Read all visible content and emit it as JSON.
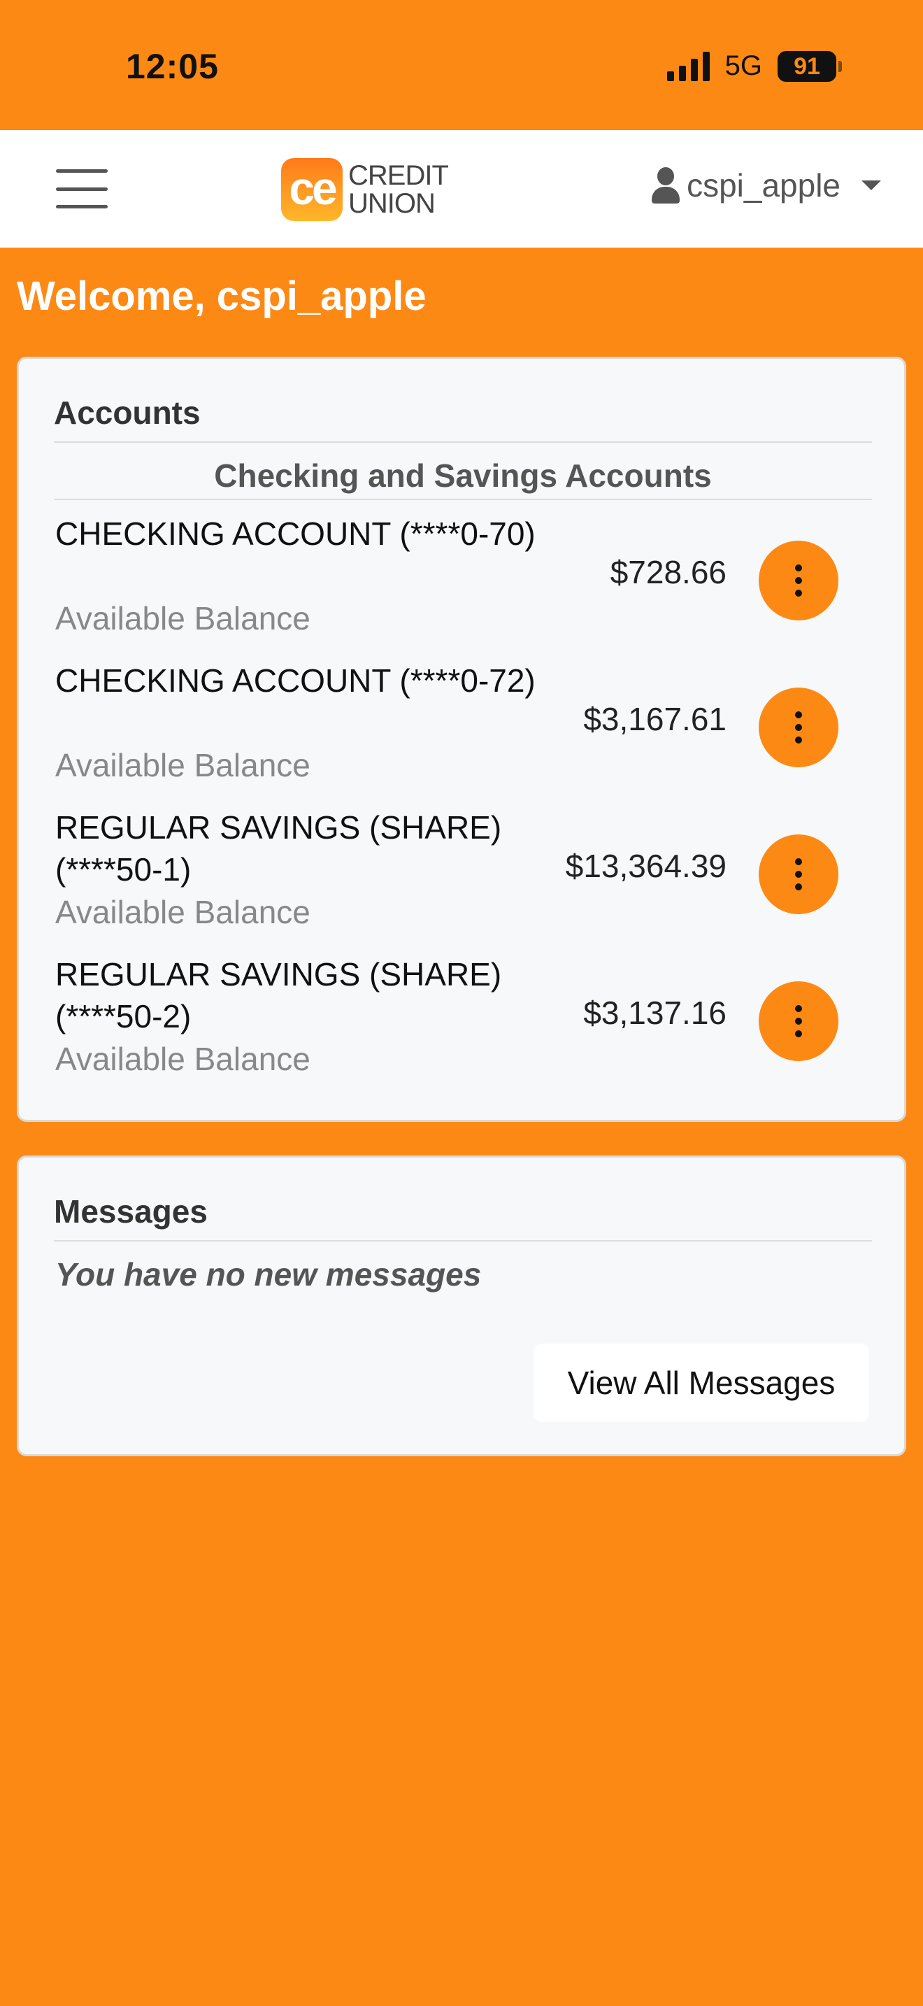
{
  "status": {
    "time": "12:05",
    "network": "5G",
    "battery": "91"
  },
  "navbar": {
    "logo_mark": "ce",
    "logo_line1": "CREDIT",
    "logo_line2": "UNION",
    "username": "cspi_apple"
  },
  "welcome": "Welcome, cspi_apple",
  "accounts": {
    "title": "Accounts",
    "section_title": "Checking and Savings Accounts",
    "items": [
      {
        "name": "CHECKING ACCOUNT (****0-70)",
        "label": "Available Balance",
        "balance": "$728.66"
      },
      {
        "name": "CHECKING ACCOUNT (****0-72)",
        "label": "Available Balance",
        "balance": "$3,167.61"
      },
      {
        "name": "REGULAR SAVINGS (SHARE) (****50-1)",
        "label": "Available Balance",
        "balance": "$13,364.39"
      },
      {
        "name": "REGULAR SAVINGS (SHARE) (****50-2)",
        "label": "Available Balance",
        "balance": "$3,137.16"
      }
    ]
  },
  "messages": {
    "title": "Messages",
    "empty_text": "You have no new messages",
    "view_all_label": "View All Messages"
  }
}
